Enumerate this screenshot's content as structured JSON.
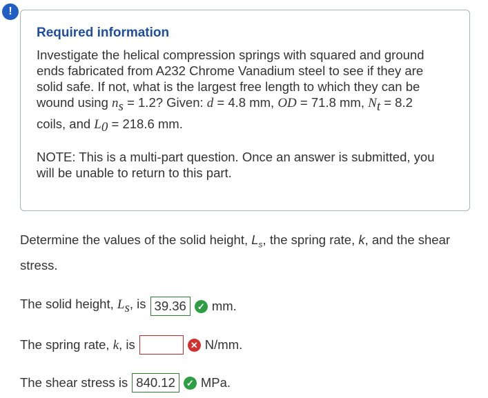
{
  "alert_glyph": "!",
  "info": {
    "title": "Required information",
    "body_parts": [
      "Investigate the helical compression springs with squared and ground ends fabricated from A232 Chrome Vanadium steel to see if they are solid safe. If not, what is the largest free length to which they can be wound using ",
      "n",
      "s",
      " = 1.2? Given: ",
      "d",
      " = 4.8 mm, ",
      "OD",
      " = 71.8 mm, ",
      "N",
      "t",
      " = 8.2 coils, and ",
      "L",
      "0",
      " = 218.6 mm."
    ],
    "note": "NOTE: This is a multi-part question. Once an answer is submitted, you will be unable to return to this part."
  },
  "question": {
    "parts": [
      "Determine the values of the solid height, ",
      "L",
      "s",
      ", the spring rate, ",
      "k",
      ", and the shear stress."
    ]
  },
  "answers": {
    "solid_height": {
      "prefix": "The solid height, ",
      "var": "L",
      "sub": "s",
      "mid": ", is",
      "value": "39.36",
      "unit": "mm.",
      "status": "correct"
    },
    "spring_rate": {
      "prefix": "The spring rate, ",
      "var": "k",
      "mid": ", is",
      "value": "",
      "unit": "N/mm.",
      "status": "incorrect"
    },
    "shear_stress": {
      "prefix": "The shear stress is",
      "value": "840.12",
      "unit": "MPa.",
      "status": "correct"
    }
  },
  "icons": {
    "correct": "check-circle-icon",
    "incorrect": "x-circle-icon"
  },
  "colors": {
    "title": "#1f4e9c",
    "correct": "#2e9e44",
    "incorrect": "#d32f2f",
    "alert": "#1f5fc4"
  }
}
